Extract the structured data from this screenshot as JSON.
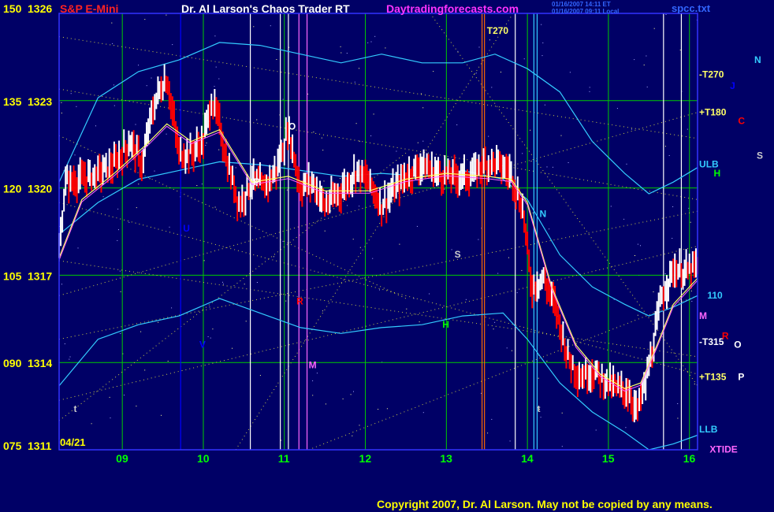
{
  "header": {
    "symbol": "S&P E-Mini",
    "app_title": "Dr. Al Larson's Chaos Trader RT",
    "website": "Daytradingforecasts.com",
    "stamp_line1": "01/16/2007 14:11 ET",
    "stamp_line2": "01/16/2007 09:11 Local",
    "file_name": "spcc.txt"
  },
  "footer": {
    "copyright": "Copyright 2007, Dr. Al Larson. May not be copied by any means."
  },
  "colors": {
    "background": "#000066",
    "plot_border": "#3333ff",
    "price_bar": "#ffffff",
    "down_bar": "#ff0000",
    "band": "#33ccff",
    "fast_avg": "#ffff66",
    "slow_avg": "#ff66ff",
    "grid_green": "#00cc00",
    "orange_line": "#ff6600"
  },
  "chart_data": {
    "type": "line",
    "title": "S&P E-Mini",
    "left_axis_ticks": [
      {
        "deg": "150",
        "price": "1326"
      },
      {
        "deg": "135",
        "price": "1323"
      },
      {
        "deg": "120",
        "price": "1320"
      },
      {
        "deg": "105",
        "price": "1317"
      },
      {
        "deg": "090",
        "price": "1314"
      },
      {
        "deg": "075",
        "price": "1311"
      }
    ],
    "ylim": [
      1311,
      1326
    ],
    "date_label": "04/21",
    "x_ticks": [
      "09",
      "10",
      "11",
      "12",
      "13",
      "14",
      "15",
      "16"
    ],
    "xlim": [
      8.22,
      16.1
    ],
    "gridlines_y": [
      1326,
      1323,
      1320,
      1317,
      1314,
      1311
    ],
    "series": [
      {
        "role": "price",
        "x": [
          8.22,
          8.3,
          8.5,
          8.7,
          8.9,
          9.1,
          9.25,
          9.35,
          9.45,
          9.55,
          9.7,
          9.85,
          10.0,
          10.1,
          10.2,
          10.3,
          10.45,
          10.6,
          10.75,
          10.9,
          11.05,
          11.2,
          11.35,
          11.5,
          11.7,
          11.9,
          12.05,
          12.2,
          12.35,
          12.5,
          12.7,
          12.9,
          13.1,
          13.3,
          13.45,
          13.6,
          13.8,
          13.95,
          14.05,
          14.2,
          14.35,
          14.5,
          14.65,
          14.8,
          14.95,
          15.1,
          15.25,
          15.35,
          15.45,
          15.55,
          15.65,
          15.8,
          15.95,
          16.1
        ],
        "y": [
          1317.8,
          1320.2,
          1320.3,
          1320.5,
          1320.8,
          1321.6,
          1320.8,
          1322.4,
          1323.3,
          1323.8,
          1321.2,
          1321.2,
          1321.6,
          1323.0,
          1322.2,
          1320.8,
          1319.4,
          1320.3,
          1320.0,
          1320.6,
          1322.0,
          1320.0,
          1320.2,
          1319.4,
          1319.9,
          1320.6,
          1320.2,
          1319.4,
          1319.9,
          1320.4,
          1320.8,
          1320.5,
          1320.4,
          1320.4,
          1320.8,
          1320.9,
          1320.5,
          1319.2,
          1316.6,
          1316.9,
          1315.9,
          1314.2,
          1313.5,
          1313.7,
          1313.4,
          1313.1,
          1313.0,
          1312.3,
          1313.2,
          1314.5,
          1316.2,
          1317.2,
          1317.1,
          1317.3
        ]
      },
      {
        "role": "fast_average",
        "x": [
          8.22,
          8.5,
          8.9,
          9.3,
          9.55,
          9.85,
          10.2,
          10.6,
          11.05,
          11.5,
          12.05,
          12.5,
          13.0,
          13.5,
          13.8,
          14.0,
          14.3,
          14.6,
          14.9,
          15.2,
          15.4,
          15.6,
          15.8,
          16.1
        ],
        "y": [
          1317.6,
          1319.6,
          1320.5,
          1321.5,
          1322.2,
          1321.6,
          1322.0,
          1320.2,
          1320.4,
          1319.9,
          1319.9,
          1320.3,
          1320.5,
          1320.4,
          1320.3,
          1319.5,
          1316.6,
          1314.6,
          1313.6,
          1313.1,
          1313.3,
          1314.6,
          1316.0,
          1316.9
        ]
      },
      {
        "role": "upper_band",
        "x": [
          8.22,
          8.7,
          9.2,
          9.7,
          10.2,
          10.7,
          11.2,
          11.7,
          12.2,
          12.7,
          13.2,
          13.6,
          14.0,
          14.4,
          14.8,
          15.2,
          15.5,
          15.8,
          16.1
        ],
        "y": [
          1320.2,
          1323.1,
          1324.0,
          1324.4,
          1325.0,
          1324.9,
          1324.6,
          1324.3,
          1324.6,
          1324.3,
          1324.3,
          1324.6,
          1324.1,
          1323.3,
          1321.6,
          1320.5,
          1319.8,
          1320.2,
          1320.7
        ]
      },
      {
        "role": "mid_band",
        "x": [
          8.22,
          8.7,
          9.2,
          9.7,
          10.2,
          10.7,
          11.2,
          11.7,
          12.2,
          12.7,
          13.2,
          13.7,
          14.0,
          14.4,
          14.8,
          15.2,
          15.5,
          15.8,
          16.1
        ],
        "y": [
          1318.4,
          1319.5,
          1320.3,
          1320.6,
          1320.9,
          1320.8,
          1320.6,
          1320.4,
          1320.5,
          1320.4,
          1320.6,
          1320.3,
          1319.6,
          1317.7,
          1316.6,
          1316.0,
          1315.6,
          1315.9,
          1316.3
        ]
      },
      {
        "role": "lower_band",
        "x": [
          8.22,
          8.7,
          9.2,
          9.7,
          10.2,
          10.7,
          11.2,
          11.7,
          12.2,
          12.7,
          13.2,
          13.7,
          14.0,
          14.4,
          14.8,
          15.2,
          15.5,
          15.8,
          16.1
        ],
        "y": [
          1313.2,
          1314.8,
          1315.3,
          1315.6,
          1316.2,
          1315.7,
          1315.2,
          1315.0,
          1315.2,
          1315.3,
          1315.6,
          1315.7,
          1314.8,
          1313.3,
          1312.3,
          1311.6,
          1311.0,
          1311.2,
          1311.5
        ]
      }
    ],
    "vertical_markers": [
      {
        "x": 9.72,
        "color": "#0000ff"
      },
      {
        "x": 10.58,
        "color": "#ffffff"
      },
      {
        "x": 10.95,
        "color": "#ffffff"
      },
      {
        "x": 11.05,
        "color": "#ffffff"
      },
      {
        "x": 11.18,
        "color": "#ff66ff"
      },
      {
        "x": 11.28,
        "color": "#ff66ff"
      },
      {
        "x": 13.44,
        "color": "#ff6600"
      },
      {
        "x": 13.47,
        "color": "#ff6600"
      },
      {
        "x": 13.85,
        "color": "#ffffff"
      },
      {
        "x": 14.08,
        "color": "#33ccff"
      },
      {
        "x": 14.12,
        "color": "#33ccff"
      },
      {
        "x": 15.68,
        "color": "#ffffff"
      },
      {
        "x": 15.9,
        "color": "#ffffff"
      }
    ],
    "annotations": [
      {
        "text": "T270",
        "x": 13.5,
        "y": 1325.3,
        "color": "#ffff66"
      },
      {
        "text": "U",
        "x": 9.75,
        "y": 1318.5,
        "color": "#0000ff"
      },
      {
        "text": "V",
        "x": 9.95,
        "y": 1314.5,
        "color": "#0000ff"
      },
      {
        "text": "P",
        "x": 10.62,
        "y": 1320.1,
        "color": "#ffffff"
      },
      {
        "text": "O",
        "x": 11.05,
        "y": 1322.0,
        "color": "#ffffff"
      },
      {
        "text": "R",
        "x": 11.15,
        "y": 1316.0,
        "color": "#ff0000"
      },
      {
        "text": "M",
        "x": 11.3,
        "y": 1313.8,
        "color": "#ff66ff"
      },
      {
        "text": "S",
        "x": 13.1,
        "y": 1317.6,
        "color": "#cccccc"
      },
      {
        "text": "H",
        "x": 12.95,
        "y": 1315.2,
        "color": "#00ff00"
      },
      {
        "text": "N",
        "x": 14.15,
        "y": 1319.0,
        "color": "#33ccff"
      },
      {
        "text": "t",
        "x": 14.12,
        "y": 1312.3,
        "color": "#cccccc"
      },
      {
        "text": "t",
        "x": 8.4,
        "y": 1312.3,
        "color": "#cccccc"
      }
    ],
    "right_labels": [
      {
        "text": "-T270",
        "x": 16.12,
        "y": 1323.8,
        "color": "#ffff66"
      },
      {
        "text": "+T180",
        "x": 16.12,
        "y": 1322.5,
        "color": "#ffff66"
      },
      {
        "text": "ULB",
        "x": 16.12,
        "y": 1320.7,
        "color": "#33ccff"
      },
      {
        "text": "H",
        "x": 16.3,
        "y": 1320.4,
        "color": "#00ff00"
      },
      {
        "text": "110",
        "x": 16.22,
        "y": 1316.2,
        "color": "#33ccff"
      },
      {
        "text": "M",
        "x": 16.12,
        "y": 1315.5,
        "color": "#ff66ff"
      },
      {
        "text": "-T315",
        "x": 16.12,
        "y": 1314.6,
        "color": "#ffffff"
      },
      {
        "text": "R",
        "x": 16.4,
        "y": 1314.8,
        "color": "#ff0000"
      },
      {
        "text": "+T135",
        "x": 16.12,
        "y": 1313.4,
        "color": "#ffff66"
      },
      {
        "text": "LLB",
        "x": 16.12,
        "y": 1311.6,
        "color": "#33ccff"
      },
      {
        "text": "XTIDE",
        "x": 16.25,
        "y": 1310.9,
        "color": "#ff66ff"
      },
      {
        "text": "N",
        "x": 16.8,
        "y": 1324.3,
        "color": "#33ccff"
      },
      {
        "text": "J",
        "x": 16.5,
        "y": 1323.4,
        "color": "#0000ff"
      },
      {
        "text": "C",
        "x": 16.6,
        "y": 1322.2,
        "color": "#ff0000"
      },
      {
        "text": "S",
        "x": 16.9,
        "y": 1321.0,
        "color": "#cccccc"
      },
      {
        "text": "O",
        "x": 16.55,
        "y": 1314.5,
        "color": "#ffffff"
      },
      {
        "text": "P",
        "x": 16.6,
        "y": 1313.4,
        "color": "#ffffff"
      }
    ],
    "grid": true
  }
}
